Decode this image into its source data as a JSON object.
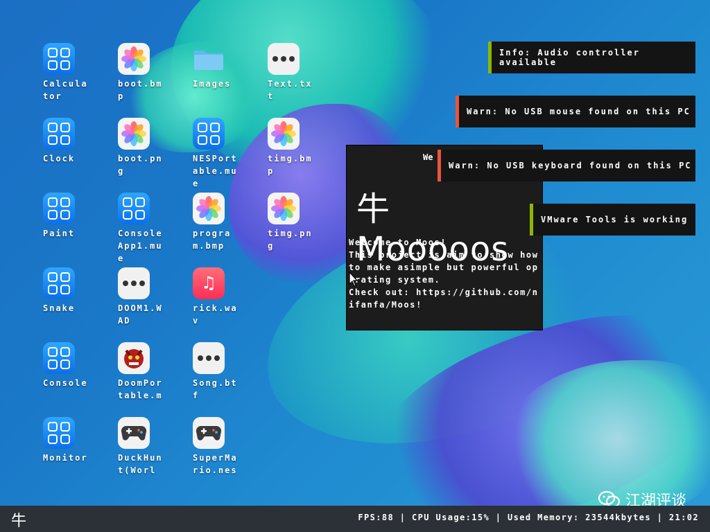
{
  "desktop_icons": [
    {
      "label": "Calculator",
      "kind": "app",
      "col": 0,
      "row": 0
    },
    {
      "label": "boot.bmp",
      "kind": "photo",
      "col": 1,
      "row": 0
    },
    {
      "label": "Images",
      "kind": "folder",
      "col": 2,
      "row": 0
    },
    {
      "label": "Text.txt",
      "kind": "dots",
      "col": 3,
      "row": 0
    },
    {
      "label": "Clock",
      "kind": "app",
      "col": 0,
      "row": 1
    },
    {
      "label": "boot.png",
      "kind": "photo",
      "col": 1,
      "row": 1
    },
    {
      "label": "NESPortable.mue",
      "kind": "app",
      "col": 2,
      "row": 1
    },
    {
      "label": "timg.bmp",
      "kind": "photo",
      "col": 3,
      "row": 1
    },
    {
      "label": "Paint",
      "kind": "app",
      "col": 0,
      "row": 2
    },
    {
      "label": "ConsoleApp1.mue",
      "kind": "app",
      "col": 1,
      "row": 2
    },
    {
      "label": "program.bmp",
      "kind": "photo",
      "col": 2,
      "row": 2
    },
    {
      "label": "timg.png",
      "kind": "photo",
      "col": 3,
      "row": 2
    },
    {
      "label": "Snake",
      "kind": "app",
      "col": 0,
      "row": 3
    },
    {
      "label": "DOOM1.WAD",
      "kind": "dots",
      "col": 1,
      "row": 3
    },
    {
      "label": "rick.wav",
      "kind": "music",
      "col": 2,
      "row": 3
    },
    {
      "label": "Console",
      "kind": "app",
      "col": 0,
      "row": 4
    },
    {
      "label": "DoomPortable.m",
      "kind": "doom",
      "col": 1,
      "row": 4
    },
    {
      "label": "Song.btf",
      "kind": "dots",
      "col": 2,
      "row": 4
    },
    {
      "label": "Monitor",
      "kind": "app",
      "col": 0,
      "row": 5
    },
    {
      "label": "DuckHunt(Worl",
      "kind": "pad",
      "col": 1,
      "row": 5
    },
    {
      "label": "SuperMario.nes",
      "kind": "pad",
      "col": 2,
      "row": 5
    }
  ],
  "notifications": [
    {
      "text": "Info: Audio controller available",
      "color": "#8db600"
    },
    {
      "text": "Warn: No USB mouse found on this PC",
      "color": "#e8553e"
    },
    {
      "text": "Warn: No USB keyboard found on this PC",
      "color": "#e8553e"
    },
    {
      "text": "VMware Tools is working",
      "color": "#8db600"
    }
  ],
  "terminal": {
    "header": "We",
    "logo_glyph": "牛",
    "logo_text": "Mooooos",
    "body": "Welcome to Moos!\nThis project is aim to show how to make asimple but powerful operating system.\nCheck out: https://github.com/nifanfa/Moos!"
  },
  "taskbar": {
    "start_glyph": "牛",
    "status": "FPS:88 | CPU Usage:15% | Used Memory: 23544kbytes | 21:02"
  },
  "watermark": {
    "text": "江湖评谈"
  },
  "colors": {
    "app_tile": "#1a8cff",
    "taskbar": "#2b3137",
    "terminal": "#1c1c1c"
  }
}
